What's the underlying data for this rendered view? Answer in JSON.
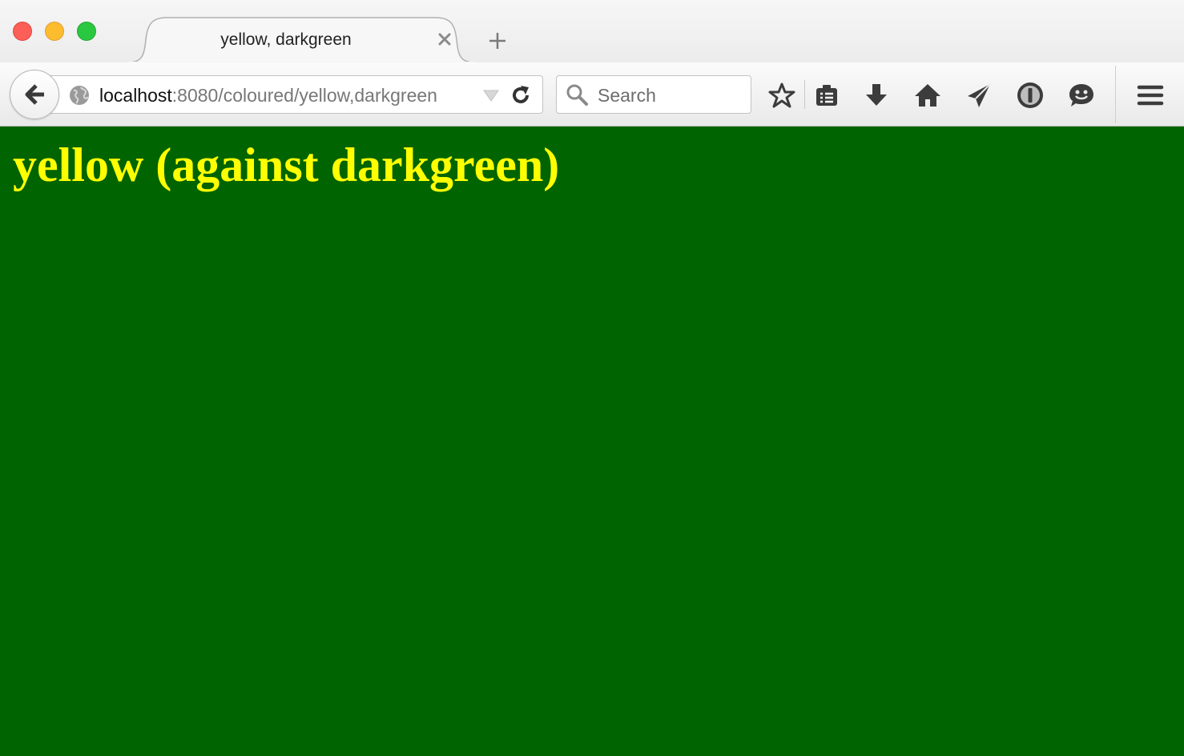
{
  "browser": {
    "tab": {
      "title": "yellow, darkgreen"
    },
    "url": {
      "host": "localhost",
      "path": ":8080/coloured/yellow,darkgreen"
    },
    "search": {
      "placeholder": "Search"
    },
    "toolbar_icons": [
      "star-icon",
      "reading-list-icon",
      "download-icon",
      "home-icon",
      "send-icon",
      "password-manager-icon",
      "chat-icon",
      "hamburger-menu-icon"
    ]
  },
  "page": {
    "heading": "yellow (against darkgreen)",
    "foreground": "#ffff00",
    "background": "#006400"
  }
}
